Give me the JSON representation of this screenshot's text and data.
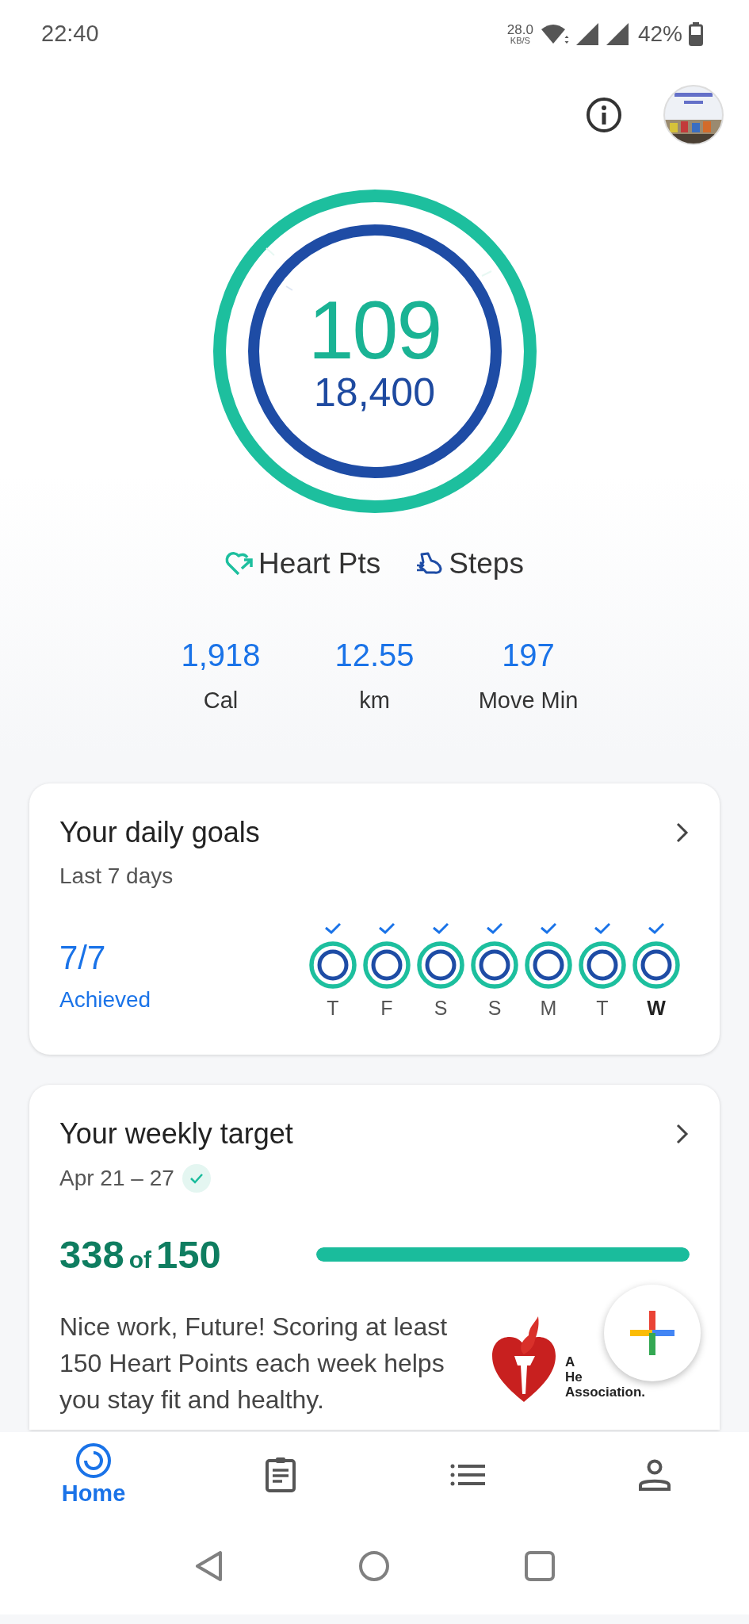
{
  "status_bar": {
    "time": "22:40",
    "net_speed": "28.0",
    "net_unit": "KB/S",
    "battery": "42%"
  },
  "summary": {
    "heart_points": "109",
    "steps": "18,400"
  },
  "legend": [
    {
      "kind": "heart",
      "label": "Heart Pts"
    },
    {
      "kind": "steps",
      "label": "Steps"
    }
  ],
  "stats": [
    {
      "value": "1,918",
      "label": "Cal"
    },
    {
      "value": "12.55",
      "label": "km"
    },
    {
      "value": "197",
      "label": "Move Min"
    }
  ],
  "daily_goals": {
    "title": "Your daily goals",
    "subtitle": "Last 7 days",
    "count": "7/7",
    "status": "Achieved",
    "days": [
      {
        "label": "T",
        "checked": true,
        "selected": false
      },
      {
        "label": "F",
        "checked": true,
        "selected": false
      },
      {
        "label": "S",
        "checked": true,
        "selected": false
      },
      {
        "label": "S",
        "checked": true,
        "selected": false
      },
      {
        "label": "M",
        "checked": true,
        "selected": false
      },
      {
        "label": "T",
        "checked": true,
        "selected": false
      },
      {
        "label": "W",
        "checked": true,
        "selected": true
      }
    ]
  },
  "weekly_target": {
    "title": "Your weekly target",
    "dates": "Apr 21 – 27",
    "met": true,
    "score": "338",
    "of": "of",
    "goal": "150",
    "level": 1,
    "message": "Nice work, Future! Scoring at least 150 Heart Points each week helps you stay fit and healthy.",
    "logo_lines": [
      "A",
      "He",
      "Association."
    ]
  },
  "bottom_nav": [
    {
      "kind": "home",
      "label": "Home",
      "selected": true
    },
    {
      "kind": "journal",
      "selected": false
    },
    {
      "kind": "browse",
      "selected": false
    },
    {
      "kind": "profile",
      "selected": false
    }
  ]
}
